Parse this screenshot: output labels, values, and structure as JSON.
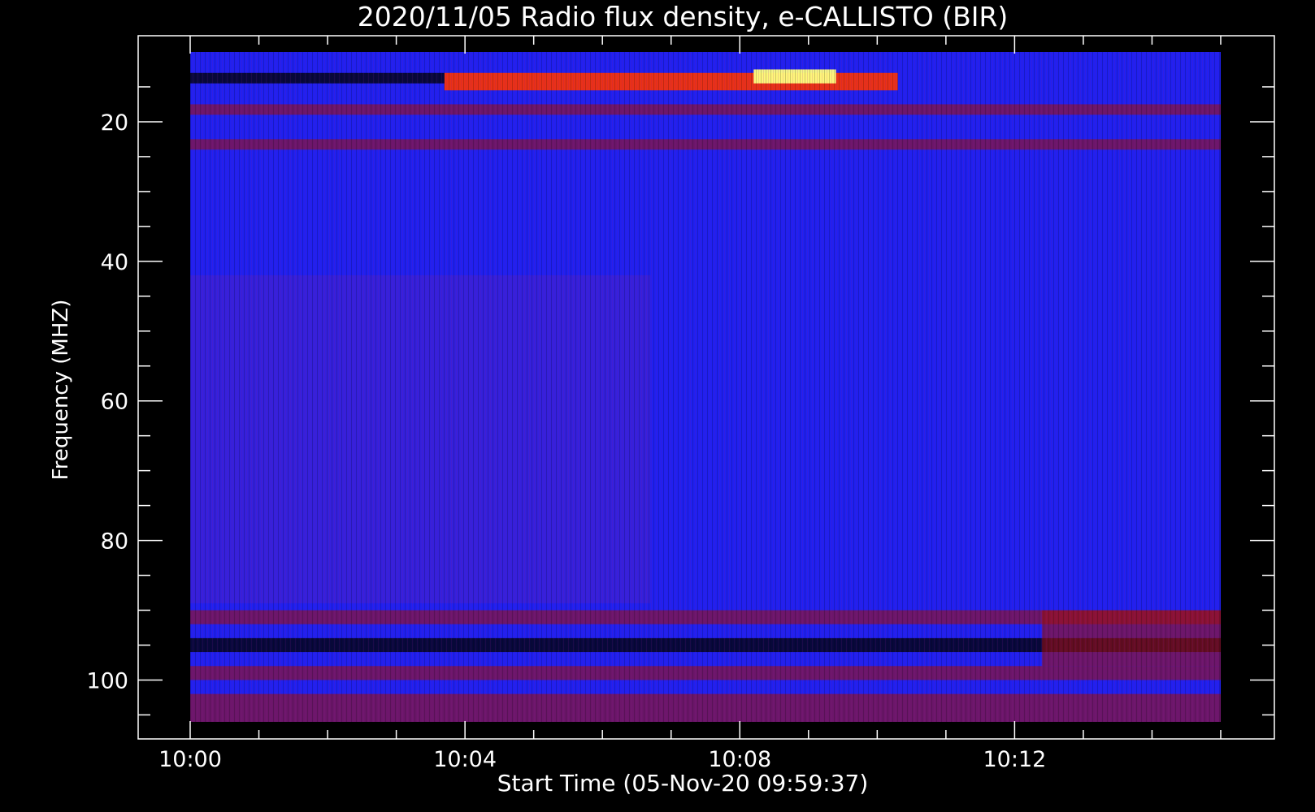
{
  "chart_data": {
    "type": "heatmap",
    "title": "2020/11/05  Radio flux density, e-CALLISTO (BIR)",
    "xlabel": "Start Time (05-Nov-20 09:59:37)",
    "ylabel": "Frequency (MHZ)",
    "x_ticks": [
      "10:00",
      "10:04",
      "10:08",
      "10:12"
    ],
    "x_tick_minutes": [
      0,
      4,
      8,
      12
    ],
    "x_range_minutes": [
      0,
      15
    ],
    "y_ticks": [
      20,
      40,
      60,
      80,
      100
    ],
    "y_range": [
      10,
      106
    ],
    "y_inverted": true,
    "background_color": "#2020f0",
    "colors": {
      "low": "#000000",
      "background": "#2020f0",
      "mid": "#a01010",
      "high": "#ff3300",
      "peak": "#ffff80"
    },
    "features": [
      {
        "kind": "burst",
        "t_start": 3.7,
        "t_end": 10.3,
        "f_low": 13,
        "f_high": 15.5,
        "intensity": "high"
      },
      {
        "kind": "burst-peak",
        "t_start": 8.2,
        "t_end": 9.4,
        "f_low": 12.5,
        "f_high": 14.5,
        "intensity": "peak"
      },
      {
        "kind": "band",
        "t_start": 0,
        "t_end": 3.7,
        "f_low": 13,
        "f_high": 14.5,
        "intensity": "low"
      },
      {
        "kind": "band",
        "t_start": 0,
        "t_end": 15,
        "f_low": 17.5,
        "f_high": 19,
        "intensity": "mid"
      },
      {
        "kind": "band",
        "t_start": 0,
        "t_end": 15,
        "f_low": 22.5,
        "f_high": 24,
        "intensity": "mid"
      },
      {
        "kind": "band",
        "t_start": 0,
        "t_end": 6.7,
        "f_low": 42,
        "f_high": 89,
        "intensity": "weak"
      },
      {
        "kind": "band",
        "t_start": 0,
        "t_end": 15,
        "f_low": 90,
        "f_high": 92,
        "intensity": "mid"
      },
      {
        "kind": "band",
        "t_start": 0,
        "t_end": 15,
        "f_low": 94,
        "f_high": 96,
        "intensity": "low"
      },
      {
        "kind": "band",
        "t_start": 0,
        "t_end": 15,
        "f_low": 98,
        "f_high": 100,
        "intensity": "mid"
      },
      {
        "kind": "band",
        "t_start": 12.4,
        "t_end": 15,
        "f_low": 90,
        "f_high": 98,
        "intensity": "mid"
      },
      {
        "kind": "band",
        "t_start": 0,
        "t_end": 15,
        "f_low": 102,
        "f_high": 106,
        "intensity": "mid"
      }
    ]
  }
}
